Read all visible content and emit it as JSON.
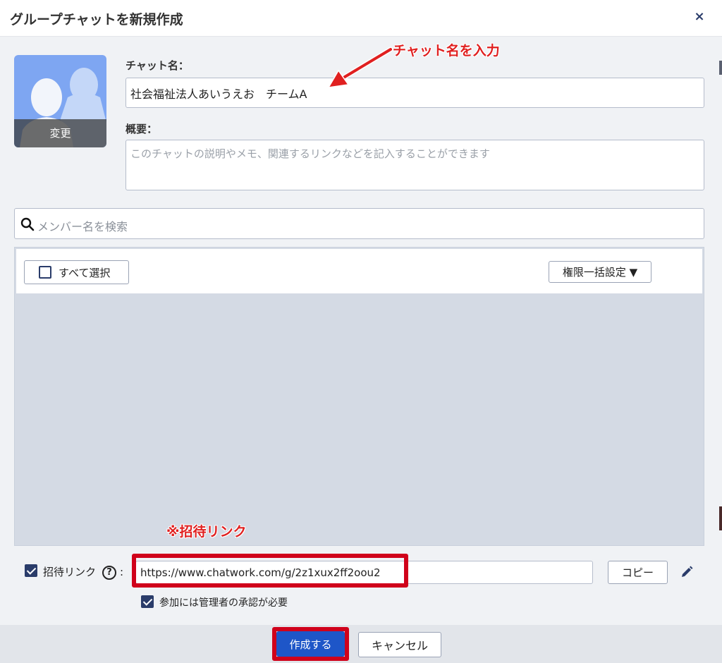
{
  "header": {
    "title": "グループチャットを新規作成",
    "close_glyph": "×"
  },
  "avatar": {
    "change_label": "変更"
  },
  "chat_name": {
    "label": "チャット名：",
    "value": "社会福祉法人あいうえお　チームA"
  },
  "overview": {
    "label": "概要：",
    "placeholder": "このチャットの説明やメモ、関連するリンクなどを記入することができます"
  },
  "annotations": {
    "chat_name_hint": "チャット名を入力",
    "invite_link_hint": "※招待リンク"
  },
  "search": {
    "placeholder": "メンバー名を検索"
  },
  "members": {
    "select_all_label": "すべて選択",
    "bulk_permission_label": "権限一括設定 ▼"
  },
  "invite": {
    "enabled": true,
    "label": "招待リンク",
    "help_glyph": "?",
    "separator": ":",
    "url": "https://www.chatwork.com/g/2z1xux2ff2oou2",
    "copy_label": "コピー",
    "approval_checked": true,
    "approval_label": "参加には管理者の承認が必要"
  },
  "footer": {
    "create_label": "作成する",
    "cancel_label": "キャンセル"
  },
  "colors": {
    "primary": "#1e56c8",
    "annotation": "#e02020",
    "highlight_box": "#d0021b",
    "avatar_bg": "#7ea6f2"
  },
  "icons": {
    "search": "search-icon",
    "edit": "pencil-icon",
    "close": "close-icon",
    "arrow": "annotation-arrow"
  }
}
